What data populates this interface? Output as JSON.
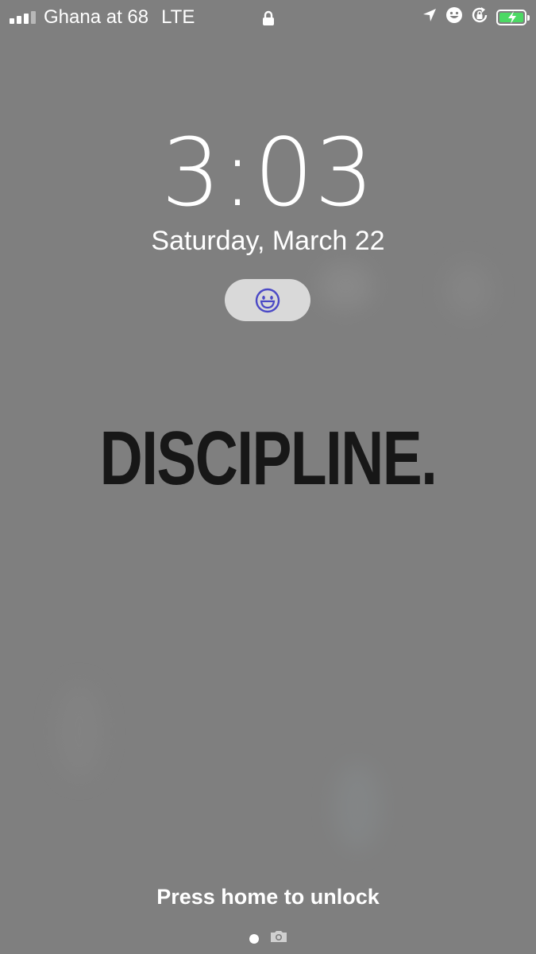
{
  "status_bar": {
    "carrier": "Ghana at 68",
    "network": "LTE",
    "icons": [
      "signal-bars-icon",
      "lock-icon",
      "location-arrow-icon",
      "smiley-icon",
      "rotation-lock-icon",
      "battery-charging-icon"
    ]
  },
  "lock_screen": {
    "time": "3:03",
    "date": "Saturday, March 22",
    "widget_icon": "smiley-face-icon",
    "widget_icon_color": "#4b49c6",
    "wallpaper_text": "DISCIPLINE.",
    "unlock_hint": "Press home to unlock",
    "page_indicator": [
      "page-dot",
      "camera-icon"
    ]
  },
  "colors": {
    "background": "#7f7f7f",
    "text": "#ffffff",
    "battery_fill": "#4cd964",
    "pill_background": "#d9d9d9"
  }
}
